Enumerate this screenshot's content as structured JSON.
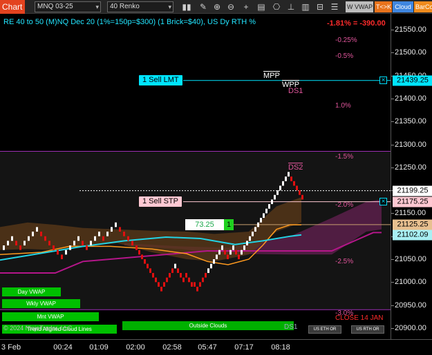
{
  "toolbar": {
    "chart_tab": "Chart",
    "instrument": "MNQ 03-25",
    "bar_type": "40 Renko",
    "buttons": [
      "W VWAP",
      "T<>K",
      "Cloud",
      "BarCo"
    ],
    "button_colors": [
      "#bdbdbd",
      "#e8731c",
      "#3f86e0",
      "#f08b1d"
    ],
    "icons": [
      "bar-style-icon",
      "draw-icon",
      "zoom-in-icon",
      "zoom-out-icon",
      "crosshair-icon",
      "properties-icon",
      "strategy-icon",
      "hold-icon",
      "chart-trader-icon",
      "data-box-icon",
      "grid-icon",
      "lock-icon"
    ]
  },
  "chart": {
    "title": "RE 40 to 50 (M)NQ Dec 20 (1%=150p=$300) (1 Brick=$40), US Dy RTH %",
    "pnl": "-1.81% = -390.00",
    "pct_levels": [
      {
        "label": "-0.25%",
        "price": 21525
      },
      {
        "label": "-0.5%",
        "price": 21490
      },
      {
        "label": "1.0%",
        "price": 21382
      },
      {
        "label": "-1.5%",
        "price": 21270
      },
      {
        "label": "-2.0%",
        "price": 21166
      },
      {
        "label": "-2.5%",
        "price": 21043
      },
      {
        "label": "-3.0%",
        "price": 20930
      }
    ],
    "orders": [
      {
        "label": "1 Sell LMT",
        "price": 21439.25,
        "color": "#00e5ff"
      },
      {
        "label": "1 Sell STP",
        "price": 21175.25,
        "color": "#ffc8d2"
      }
    ],
    "position_qty": "73.25",
    "position_count": "1",
    "markers": [
      {
        "text": "MPP",
        "color": "#ffffff"
      },
      {
        "text": "WPP",
        "color": "#ffffff"
      },
      {
        "text": "DS1",
        "color": "#e0559b"
      },
      {
        "text": "DS2",
        "color": "#e0559b"
      }
    ],
    "close_label": "CLOSE 14 JAN",
    "copyright": "© 2024 NinjaTrader, LLC",
    "indicator_buttons": [
      {
        "label": "Day VWAP",
        "color": "#00c000"
      },
      {
        "label": "Wkly VWAP",
        "color": "#00c000"
      },
      {
        "label": "Mnt VWAP",
        "color": "#00c000"
      },
      {
        "label": "Trend Aligned Cloud Lines",
        "color": "#00c000"
      },
      {
        "label": "Outside Clouds",
        "color": "#00b000"
      }
    ],
    "session_buttons": [
      "US ETH OR",
      "US RTH OR"
    ],
    "ds1_label": "DS1"
  },
  "price_axis": {
    "ticks": [
      "21550.00",
      "21500.00",
      "21450.00",
      "21400.00",
      "21350.00",
      "21300.00",
      "21250.00",
      "21200.00",
      "21150.00",
      "21100.00",
      "21050.00",
      "21000.00",
      "20950.00",
      "20900.00"
    ],
    "tick_values": [
      21550,
      21500,
      21450,
      21400,
      21350,
      21300,
      21250,
      21200,
      21150,
      21100,
      21050,
      21000,
      20950,
      20900
    ],
    "boxes": [
      {
        "label": "21439.25",
        "price": 21439.25,
        "color": "#00e5ff"
      },
      {
        "label": "21199.25",
        "price": 21199.25,
        "color": "#ffffff"
      },
      {
        "label": "21175.25",
        "price": 21175.25,
        "color": "#ffc8d2"
      },
      {
        "label": "21125.25",
        "price": 21125.25,
        "color": "#e8c090"
      },
      {
        "label": "21102.09",
        "price": 21102.09,
        "color": "#a8f0f4"
      }
    ]
  },
  "time_axis": {
    "ticks": [
      "3 Feb",
      "00:24",
      "01:09",
      "02:00",
      "02:58",
      "05:47",
      "07:17",
      "08:18"
    ]
  },
  "series": {
    "vwap_day": [
      [
        0,
        21048
      ],
      [
        80,
        21068
      ],
      [
        120,
        21078
      ],
      [
        180,
        21090
      ],
      [
        240,
        21098
      ],
      [
        290,
        21095
      ],
      [
        340,
        21082
      ],
      [
        380,
        21090
      ],
      [
        420,
        21100
      ],
      [
        436,
        21103
      ]
    ],
    "vwap_orange": [
      [
        0,
        21060
      ],
      [
        60,
        21065
      ],
      [
        100,
        21078
      ],
      [
        160,
        21078
      ],
      [
        220,
        21072
      ],
      [
        270,
        21062
      ],
      [
        300,
        21045
      ],
      [
        330,
        21038
      ],
      [
        360,
        21050
      ],
      [
        380,
        21080
      ],
      [
        400,
        21115
      ],
      [
        420,
        21125
      ],
      [
        436,
        21125
      ]
    ],
    "cloud_upper": [
      [
        0,
        21120
      ],
      [
        40,
        21130
      ],
      [
        80,
        21125
      ],
      [
        120,
        21118
      ],
      [
        170,
        21115
      ],
      [
        220,
        21112
      ],
      [
        270,
        21110
      ],
      [
        310,
        21105
      ],
      [
        360,
        21110
      ],
      [
        400,
        21165
      ],
      [
        436,
        21185
      ]
    ],
    "cloud_lower": [
      [
        0,
        21070
      ],
      [
        40,
        21072
      ],
      [
        80,
        21070
      ],
      [
        120,
        21078
      ],
      [
        170,
        21085
      ],
      [
        220,
        21065
      ],
      [
        270,
        21050
      ],
      [
        310,
        21045
      ],
      [
        360,
        21060
      ],
      [
        400,
        21110
      ],
      [
        436,
        21130
      ]
    ],
    "purple_line": [
      [
        0,
        21020
      ],
      [
        80,
        21020
      ],
      [
        120,
        21045
      ],
      [
        300,
        21068
      ],
      [
        480,
        21068
      ],
      [
        540,
        21108
      ],
      [
        552,
        21108
      ]
    ],
    "purple_cloud_upper": [
      [
        180,
        21085
      ],
      [
        260,
        21078
      ],
      [
        330,
        21075
      ],
      [
        420,
        21100
      ],
      [
        480,
        21140
      ],
      [
        530,
        21175
      ],
      [
        552,
        21180
      ]
    ],
    "purple_cloud_lower": [
      [
        180,
        21080
      ],
      [
        260,
        21072
      ],
      [
        330,
        21062
      ],
      [
        420,
        21060
      ],
      [
        480,
        21060
      ],
      [
        530,
        21110
      ],
      [
        552,
        21115
      ]
    ],
    "bricks": [
      [
        4,
        21080
      ],
      [
        10,
        21090
      ],
      [
        16,
        21100
      ],
      [
        22,
        21090
      ],
      [
        28,
        21080
      ],
      [
        34,
        21090
      ],
      [
        40,
        21100
      ],
      [
        46,
        21110
      ],
      [
        52,
        21120
      ],
      [
        58,
        21110
      ],
      [
        64,
        21100
      ],
      [
        70,
        21090
      ],
      [
        76,
        21080
      ],
      [
        82,
        21070
      ],
      [
        88,
        21060
      ],
      [
        94,
        21070
      ],
      [
        100,
        21080
      ],
      [
        106,
        21090
      ],
      [
        112,
        21100
      ],
      [
        118,
        21090
      ],
      [
        124,
        21080
      ],
      [
        130,
        21090
      ],
      [
        136,
        21100
      ],
      [
        142,
        21110
      ],
      [
        148,
        21100
      ],
      [
        154,
        21110
      ],
      [
        160,
        21120
      ],
      [
        166,
        21130
      ],
      [
        172,
        21120
      ],
      [
        178,
        21110
      ],
      [
        184,
        21100
      ],
      [
        190,
        21090
      ],
      [
        196,
        21080
      ],
      [
        200,
        21070
      ],
      [
        204,
        21060
      ],
      [
        208,
        21050
      ],
      [
        212,
        21040
      ],
      [
        216,
        21030
      ],
      [
        220,
        21020
      ],
      [
        224,
        21010
      ],
      [
        228,
        21000
      ],
      [
        232,
        20990
      ],
      [
        236,
        21000
      ],
      [
        240,
        21010
      ],
      [
        244,
        21020
      ],
      [
        248,
        21030
      ],
      [
        252,
        21040
      ],
      [
        256,
        21030
      ],
      [
        260,
        21020
      ],
      [
        264,
        21010
      ],
      [
        268,
        21020
      ],
      [
        272,
        21010
      ],
      [
        276,
        21000
      ],
      [
        280,
        21000
      ],
      [
        284,
        20990
      ],
      [
        288,
        21000
      ],
      [
        292,
        21010
      ],
      [
        296,
        21020
      ],
      [
        300,
        21030
      ],
      [
        304,
        21040
      ],
      [
        308,
        21050
      ],
      [
        312,
        21060
      ],
      [
        316,
        21070
      ],
      [
        320,
        21080
      ],
      [
        324,
        21070
      ],
      [
        328,
        21060
      ],
      [
        332,
        21070
      ],
      [
        336,
        21080
      ],
      [
        340,
        21070
      ],
      [
        344,
        21060
      ],
      [
        348,
        21070
      ],
      [
        352,
        21080
      ],
      [
        356,
        21090
      ],
      [
        360,
        21100
      ],
      [
        364,
        21110
      ],
      [
        368,
        21120
      ],
      [
        372,
        21130
      ],
      [
        376,
        21140
      ],
      [
        380,
        21150
      ],
      [
        384,
        21160
      ],
      [
        388,
        21170
      ],
      [
        392,
        21180
      ],
      [
        396,
        21190
      ],
      [
        400,
        21200
      ],
      [
        404,
        21210
      ],
      [
        408,
        21220
      ],
      [
        412,
        21230
      ],
      [
        416,
        21240
      ],
      [
        420,
        21230
      ],
      [
        424,
        21220
      ],
      [
        428,
        21210
      ],
      [
        432,
        21200
      ],
      [
        436,
        21190
      ]
    ]
  }
}
